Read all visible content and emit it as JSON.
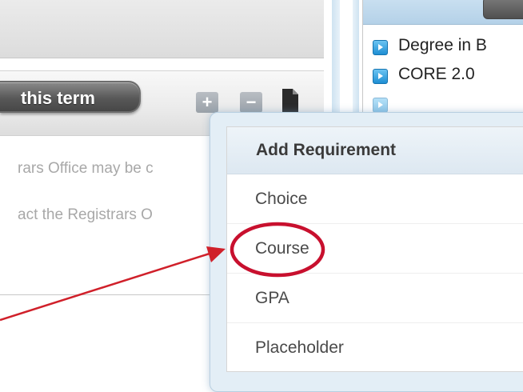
{
  "left_panel": {
    "term_button_label": "this term",
    "add_icon": "plus-icon",
    "remove_icon": "minus-icon",
    "document_icon": "document-icon",
    "notice_line_1": "rars Office may be c",
    "notice_line_2": "act the Registrars O"
  },
  "requirement_tree": {
    "items": [
      {
        "label": "Degree in B",
        "icon": "degree-icon"
      },
      {
        "label": "CORE 2.0",
        "icon": "degree-icon"
      },
      {
        "label": "",
        "icon": "degree-icon"
      }
    ]
  },
  "add_requirement_menu": {
    "title": "Add Requirement",
    "options": [
      "Choice",
      "Course",
      "GPA",
      "Placeholder"
    ],
    "highlighted_option": "Course"
  },
  "colors": {
    "annotation": "#d0202a",
    "popup_border": "#b8cfe1",
    "tree_icon": "#1e8ed3"
  }
}
